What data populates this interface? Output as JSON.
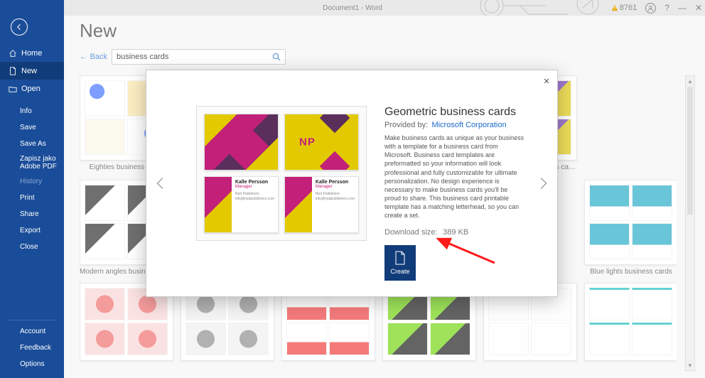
{
  "app": {
    "title": "Document1 - Word"
  },
  "topbar": {
    "warning_count": "8761",
    "help": "?",
    "minimize": "—",
    "close_glyph": "✕"
  },
  "sidebar": {
    "home": "Home",
    "new": "New",
    "open": "Open",
    "items": [
      "Info",
      "Save",
      "Save As",
      "Zapisz jako\nAdobe PDF",
      "History",
      "Print",
      "Share",
      "Export",
      "Close"
    ],
    "bottom": [
      "Account",
      "Feedback",
      "Options"
    ]
  },
  "page": {
    "heading": "New",
    "back": "Back",
    "search_value": "business cards"
  },
  "templates_row1": [
    {
      "label": "Eighties business cards",
      "scheme": "sch-eighties"
    },
    {
      "label": "Modern angles business cards",
      "scheme": "sch-modern"
    },
    {
      "label": "",
      "scheme": "sch-plain"
    },
    {
      "label": "",
      "scheme": "sch-plain"
    },
    {
      "label": "Purple graphic business cards",
      "scheme": "sch-purple"
    },
    {
      "label": "Blue lights business cards",
      "scheme": "sch-blue"
    }
  ],
  "templates_row2": [
    {
      "scheme": "sch-pink"
    },
    {
      "scheme": "sch-gray"
    },
    {
      "scheme": "sch-flower"
    },
    {
      "scheme": "sch-green"
    },
    {
      "scheme": "sch-plain"
    },
    {
      "scheme": "sch-teal"
    }
  ],
  "modal": {
    "title": "Geometric business cards",
    "provided_by_label": "Provided by:",
    "provided_by": "Microsoft Corporation",
    "description": "Make business cards as unique as your business with a template for a business card from Microsoft. Business card templates are preformatted so your information will look professional and fully customizable for ultimate personalization. No design experience is necessary to make business cards you'll be proud to share. This business card printable template has a matching letterhead, so you can create a set.",
    "download_label": "Download size:",
    "download_size": "389 KB",
    "create": "Create",
    "card_name_lines": "Nod\nPublishers",
    "monogram": "NP",
    "person_name": "Kalle Persson",
    "person_role": "Manager"
  }
}
